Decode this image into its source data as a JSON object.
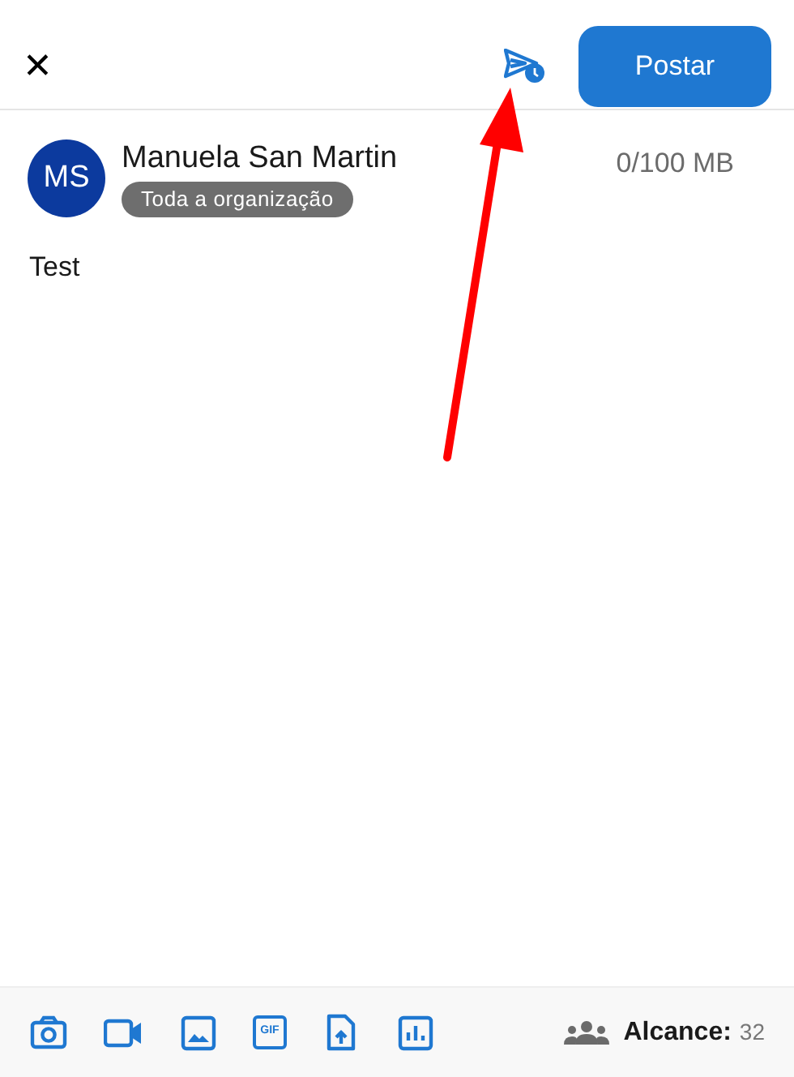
{
  "header": {
    "close": "✕",
    "post_button": "Postar"
  },
  "author": {
    "initials": "MS",
    "name": "Manuela San Martin",
    "audience": "Toda a organização",
    "storage": "0/100 MB"
  },
  "post_text": "Test",
  "toolbar": {
    "items": [
      {
        "kind": "camera"
      },
      {
        "kind": "video"
      },
      {
        "kind": "image"
      },
      {
        "kind": "gif",
        "label": "GIF"
      },
      {
        "kind": "file"
      },
      {
        "kind": "poll"
      }
    ],
    "reach_label": "Alcance:",
    "reach_count": "32"
  }
}
